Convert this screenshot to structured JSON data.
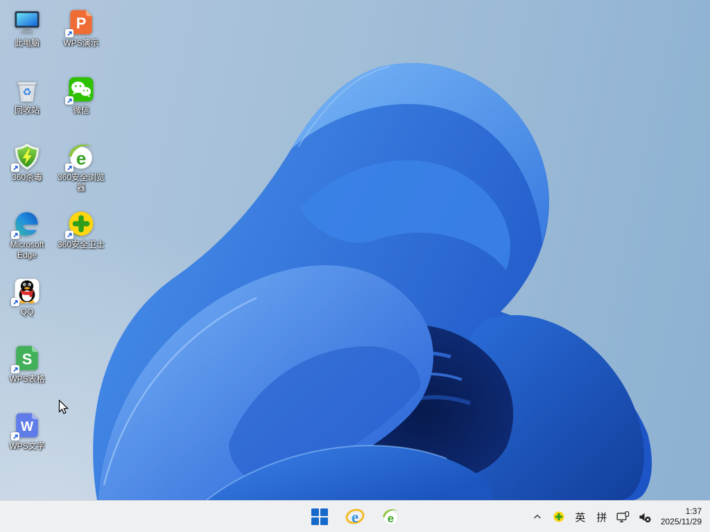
{
  "desktop": {
    "icons": [
      {
        "name": "this-pc",
        "label": "此电脑"
      },
      {
        "name": "wps-presentation",
        "label": "WPS演示",
        "glyph": "P"
      },
      {
        "name": "recycle-bin",
        "label": "回收站",
        "glyph": "♻"
      },
      {
        "name": "wechat",
        "label": "微信"
      },
      {
        "name": "360-antivirus",
        "label": "360杀毒"
      },
      {
        "name": "360-secure-browser",
        "label": "360安全浏览器",
        "glyph": "e"
      },
      {
        "name": "microsoft-edge",
        "label": "Microsoft Edge"
      },
      {
        "name": "360-safeguard",
        "label": "360安全卫士"
      },
      {
        "name": "qq",
        "label": "QQ"
      },
      {
        "name": "wps-spreadsheet",
        "label": "WPS表格",
        "glyph": "S"
      },
      {
        "name": "wps-writer",
        "label": "WPS文字",
        "glyph": "W"
      }
    ]
  },
  "taskbar": {
    "start": {
      "name": "windows-start"
    },
    "pinned": [
      {
        "name": "internet-explorer",
        "glyph": "e"
      },
      {
        "name": "360-secure-browser",
        "glyph": "e"
      }
    ],
    "tray": {
      "chevron_icon": "hidden-icons-chevron",
      "safeguard_icon": "360-safeguard-tray",
      "lang": "英",
      "ime": "拼",
      "network_icon": "ethernet-network",
      "volume_icon": "volume-muted"
    },
    "clock": {
      "time": "1:37",
      "date": "2025/11/29"
    }
  },
  "colors": {
    "taskbar_bg": "#eff0f2",
    "sky_top_right": "#8db1d2",
    "sky_bottom_left": "#ccd9e7",
    "bloom_blue": "#2a6fe0",
    "bloom_dark": "#0a1e55",
    "start_blue": "#1569ca"
  }
}
